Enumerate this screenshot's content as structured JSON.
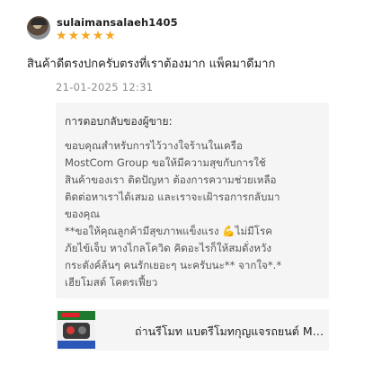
{
  "review": {
    "username": "sulaimansalaeh1405",
    "rating": 5,
    "stars": [
      "★",
      "★",
      "★",
      "★",
      "★"
    ],
    "text": "สินค้าดีตรงปกครับตรงที่เราต้องมาก แพ็คมาดีมาก",
    "date": "21-01-2025 12:31"
  },
  "seller_response": {
    "title": "การตอบกลับของผู้ขาย:",
    "lines": [
      "ขอบคุณสำหรับการไว้วางใจร้านในเครือ",
      "MostCom Group ขอให้มีความสุขกับการใช้",
      "สินค้าของเรา ติดปัญหา ต้องการความช่วยเหลือ",
      "ติดต่อหาเราได้เสมอ และเราจะเฝ้ารอการกลับมา",
      "ของคุณ",
      "**ขอให้คุณลูกค้ามีสุขภาพแข็งแรง 💪ไม่มีโรค",
      "ภัยไข้เจ็บ หางไกลโควิด คิดอะไรก็ให้สมดั่งหวัง",
      "กระตังค์ล้นๆ คนรักเยอะๆ นะครับนะ** จากใจ*.*",
      "เฮียโมสต์ โคตรเฟี้ยว"
    ]
  },
  "product": {
    "name": "ถ่านรีโมท แบตรีโมทกุญแจรถยนต์ Ma..."
  },
  "colors": {
    "star": "#f5a623",
    "date": "#8c8c8c",
    "box_bg": "#f5f5f5"
  }
}
